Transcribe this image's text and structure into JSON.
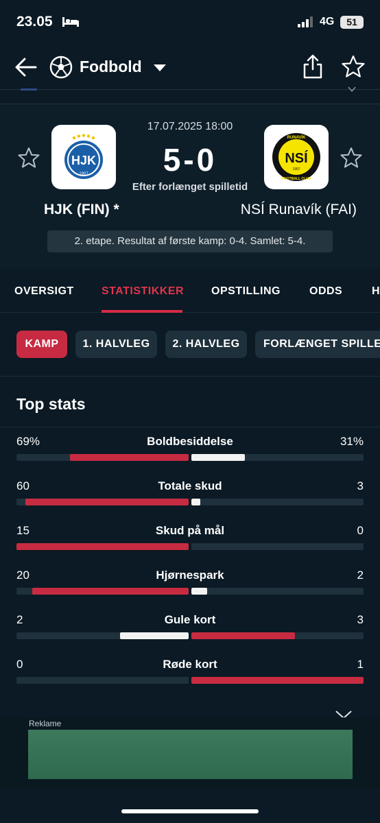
{
  "status_bar": {
    "time": "23.05",
    "network": "4G",
    "battery": "51"
  },
  "nav": {
    "title": "Fodbold"
  },
  "match": {
    "date": "17.07.2025 18:00",
    "score": "5-0",
    "note": "Efter forlænget spilletid",
    "home_team": "HJK (FIN) *",
    "away_team": "NSÍ Runavík (FAI)",
    "aggregate": "2. etape. Resultat af første kamp: 0-4. Samlet: 5-4.",
    "home_logo": {
      "text": "HJK",
      "year": "1907",
      "colors": [
        "#1b5fa8",
        "#ffffff",
        "#f2c400"
      ]
    },
    "away_logo": {
      "text": "NSÍ",
      "top": "RUNAVÍK",
      "bottom": "FOOTBALL CLUB",
      "year": "1957",
      "colors": [
        "#f5e400",
        "#111111"
      ]
    }
  },
  "tabs": [
    {
      "label": "OVERSIGT",
      "active": false
    },
    {
      "label": "STATISTIKKER",
      "active": true
    },
    {
      "label": "OPSTILLING",
      "active": false
    },
    {
      "label": "ODDS",
      "active": false
    },
    {
      "label": "H",
      "active": false
    }
  ],
  "periods": [
    {
      "label": "KAMP",
      "active": true
    },
    {
      "label": "1. HALVLEG",
      "active": false
    },
    {
      "label": "2. HALVLEG",
      "active": false
    },
    {
      "label": "FORLÆNGET SPILLET",
      "active": false
    }
  ],
  "section_title": "Top stats",
  "colors": {
    "home_bar": "#c72b41",
    "away_bar": "#f2f2f2",
    "away_highlight": "#c72b41",
    "background": "#0b1a24"
  },
  "stats": [
    {
      "label": "Boldbesiddelse",
      "home": "69%",
      "away": "31%",
      "home_fraction": 0.69,
      "away_fraction": 0.31,
      "away_color": "#f2f2f2"
    },
    {
      "label": "Totale skud",
      "home": "60",
      "away": "3",
      "home_fraction": 0.95,
      "away_fraction": 0.05,
      "away_color": "#f2f2f2"
    },
    {
      "label": "Skud på mål",
      "home": "15",
      "away": "0",
      "home_fraction": 1.0,
      "away_fraction": 0.0,
      "away_color": "#f2f2f2"
    },
    {
      "label": "Hjørnespark",
      "home": "20",
      "away": "2",
      "home_fraction": 0.91,
      "away_fraction": 0.09,
      "away_color": "#f2f2f2"
    },
    {
      "label": "Gule kort",
      "home": "2",
      "away": "3",
      "home_fraction": 0.4,
      "away_fraction": 0.6,
      "away_color": "#c72b41",
      "home_color": "#f2f2f2"
    },
    {
      "label": "Røde kort",
      "home": "0",
      "away": "1",
      "home_fraction": 0.0,
      "away_fraction": 1.0,
      "away_color": "#c72b41"
    }
  ],
  "ad": {
    "label": "Reklame"
  }
}
